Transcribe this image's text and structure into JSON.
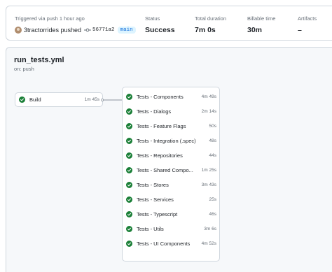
{
  "summary": {
    "trigger": "Triggered via push 1 hour ago",
    "actor": "3tractorrides pushed",
    "commit_sha": "56771a2",
    "branch": "main",
    "stats": [
      {
        "label": "Status",
        "value": "Success"
      },
      {
        "label": "Total duration",
        "value": "7m 0s"
      },
      {
        "label": "Billable time",
        "value": "30m"
      },
      {
        "label": "Artifacts",
        "value": "–"
      }
    ]
  },
  "workflow": {
    "file": "run_tests.yml",
    "event": "on: push",
    "build": {
      "name": "Build",
      "duration": "1m 45s"
    },
    "jobs": [
      {
        "name": "Tests - Components",
        "duration": "4m 49s"
      },
      {
        "name": "Tests - Dialogs",
        "duration": "2m 14s"
      },
      {
        "name": "Tests - Feature Flags",
        "duration": "50s"
      },
      {
        "name": "Tests - Integration (.spec)",
        "duration": "48s"
      },
      {
        "name": "Tests - Repositories",
        "duration": "44s"
      },
      {
        "name": "Tests - Shared Compo...",
        "duration": "1m 25s"
      },
      {
        "name": "Tests - Stores",
        "duration": "3m 43s"
      },
      {
        "name": "Tests - Services",
        "duration": "25s"
      },
      {
        "name": "Tests - Typescript",
        "duration": "46s"
      },
      {
        "name": "Tests - Utils",
        "duration": "3m 6s"
      },
      {
        "name": "Tests - UI Components",
        "duration": "4m 52s"
      }
    ]
  },
  "colors": {
    "success": "#1a7f37",
    "link": "#0969da",
    "muted": "#656d76",
    "border": "#d0d7de"
  },
  "icons": {
    "job_status": "check-circle-fill-icon",
    "commit": "git-commit-icon"
  }
}
